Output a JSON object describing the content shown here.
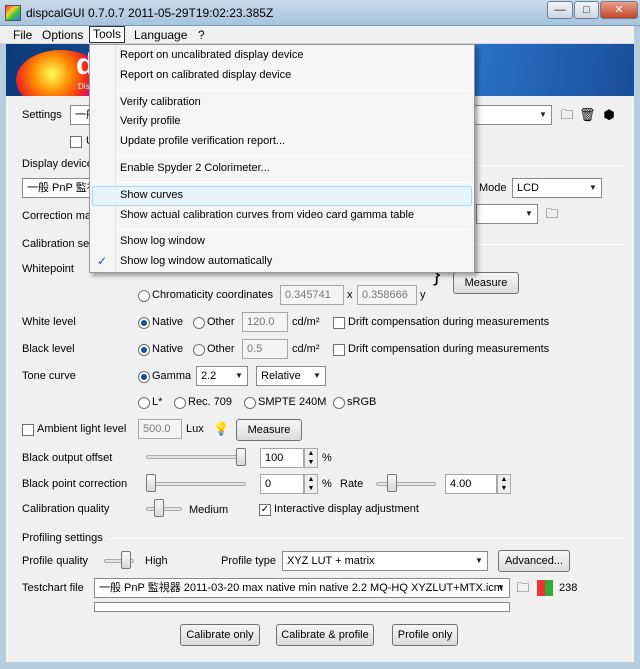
{
  "window": {
    "title": "dispcalGUI 0.7.0.7 2011-05-29T19:02:23.385Z",
    "minimize": "—",
    "maximize": "□",
    "close": "✕"
  },
  "menubar": {
    "items": [
      "File",
      "Options",
      "Tools",
      "Language",
      "?"
    ]
  },
  "banner": {
    "big": "d",
    "small": "Dis"
  },
  "tools_menu": {
    "items": [
      "Report on uncalibrated display device",
      "Report on calibrated display device",
      "Verify calibration",
      "Verify profile",
      "Update profile verification report...",
      "Enable Spyder 2 Colorimeter...",
      "Show curves",
      "Show actual calibration curves from video card gamma table",
      "Show log window",
      "Show log window automatically"
    ],
    "highlighted": "Show curves",
    "checked": "Show log window automatically",
    "check_glyph": "✓"
  },
  "settings": {
    "label": "Settings",
    "value": "一般",
    "checkbox_label": "U"
  },
  "display_device": {
    "section": "Display device",
    "device_value": "一般 PnP 監視",
    "mode_label": "Mode",
    "mode_value": "LCD",
    "correction_label": "Correction ma"
  },
  "calibration": {
    "section": "Calibration set",
    "whitepoint_label": "Whitepoint",
    "chromaticity_label": "Chromaticity coordinates",
    "chroma_x": "0.345741",
    "x_label": "x",
    "chroma_y": "0.358666",
    "y_label": "y",
    "brace": "}",
    "measure_btn": "Measure",
    "white_level_label": "White level",
    "native_label": "Native",
    "other_label": "Other",
    "white_other_value": "120.0",
    "unit_cdm2": "cd/m²",
    "drift_label": "Drift compensation during measurements",
    "black_level_label": "Black level",
    "black_other_value": "0.5",
    "tone_curve_label": "Tone curve",
    "gamma_label": "Gamma",
    "gamma_value": "2.2",
    "gamma_mode": "Relative",
    "lstar_label": "L*",
    "rec709_label": "Rec. 709",
    "smpte_label": "SMPTE 240M",
    "srgb_label": "sRGB",
    "ambient_label": "Ambient light level",
    "ambient_value": "500.0",
    "lux_label": "Lux",
    "ambient_measure": "Measure",
    "black_output_label": "Black output offset",
    "black_output_value": "100",
    "black_output_level": 1.0,
    "percent": "%",
    "bpc_label": "Black point correction",
    "bpc_value": "0",
    "bpc_level": 0.0,
    "rate_label": "Rate",
    "rate_value": "4.00",
    "quality_label": "Calibration quality",
    "quality_value": "Medium",
    "interactive_label": "Interactive display adjustment"
  },
  "profiling": {
    "section": "Profiling settings",
    "quality_label": "Profile quality",
    "quality_value": "High",
    "type_label": "Profile type",
    "type_value": "XYZ LUT + matrix",
    "advanced_btn": "Advanced...",
    "testchart_label": "Testchart file",
    "testchart_value": "一般 PnP 監視器 2011-03-20 max native min native 2.2 MQ-HQ XYZLUT+MTX.icm",
    "testchart_count": "238"
  },
  "footer": {
    "calibrate_only": "Calibrate only",
    "calibrate_profile": "Calibrate & profile",
    "profile_only": "Profile only"
  },
  "colors": {
    "accent": "#1b4e9b",
    "highlight": "#e6f3fc",
    "frame": "#b8cce0"
  }
}
